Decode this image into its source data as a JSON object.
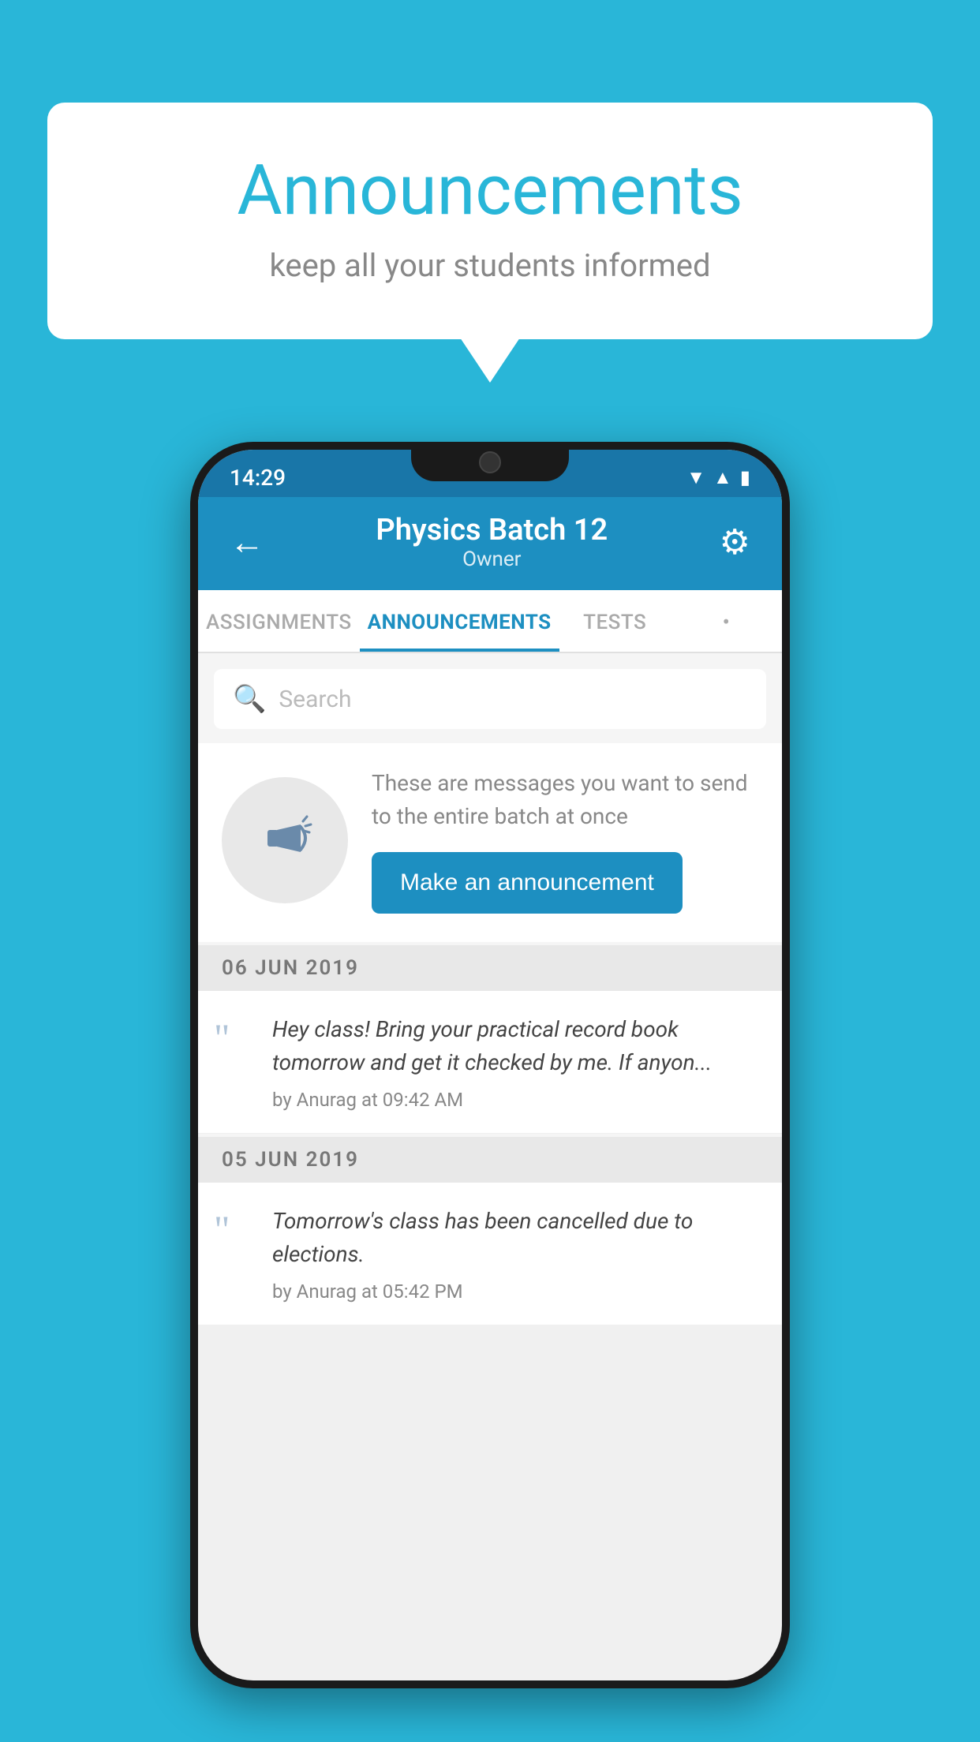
{
  "background_color": "#29b6d8",
  "speech_bubble": {
    "title": "Announcements",
    "subtitle": "keep all your students informed"
  },
  "phone": {
    "status_bar": {
      "time": "14:29",
      "wifi_icon": "▼",
      "signal_icon": "▲",
      "battery_icon": "▮"
    },
    "header": {
      "back_icon": "←",
      "title": "Physics Batch 12",
      "subtitle": "Owner",
      "settings_icon": "⚙"
    },
    "tabs": [
      {
        "label": "ASSIGNMENTS",
        "active": false
      },
      {
        "label": "ANNOUNCEMENTS",
        "active": true
      },
      {
        "label": "TESTS",
        "active": false
      },
      {
        "label": "•",
        "active": false
      }
    ],
    "search": {
      "placeholder": "Search"
    },
    "promo": {
      "description": "These are messages you want to send to the entire batch at once",
      "button_label": "Make an announcement"
    },
    "announcements": [
      {
        "date": "06  JUN  2019",
        "text": "Hey class! Bring your practical record book tomorrow and get it checked by me. If anyon...",
        "meta": "by Anurag at 09:42 AM"
      },
      {
        "date": "05  JUN  2019",
        "text": "Tomorrow's class has been cancelled due to elections.",
        "meta": "by Anurag at 05:42 PM"
      }
    ]
  }
}
